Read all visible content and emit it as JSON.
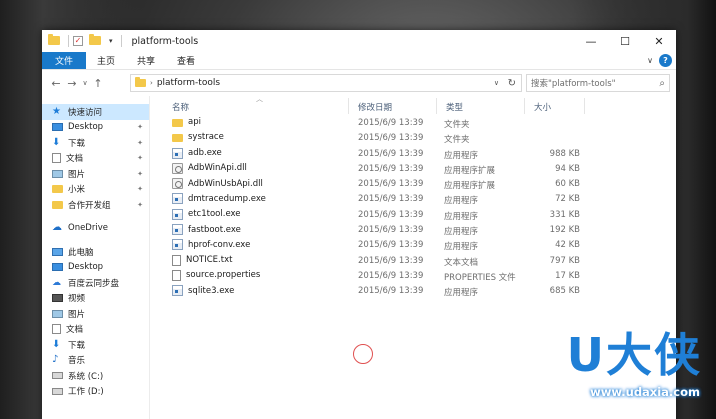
{
  "window": {
    "title": "platform-tools",
    "controls": {
      "minimize": "—",
      "maximize": "☐",
      "close": "✕"
    }
  },
  "ribbon": {
    "tabs": [
      "文件",
      "主页",
      "共享",
      "查看"
    ],
    "help": "?"
  },
  "nav": {
    "path": "platform-tools",
    "search_placeholder": "搜索\"platform-tools\""
  },
  "sidebar": {
    "items": [
      {
        "label": "快速访问",
        "icon": "star-icon",
        "selected": true,
        "pinned": false
      },
      {
        "label": "Desktop",
        "icon": "desktop-icon",
        "pinned": true
      },
      {
        "label": "下载",
        "icon": "download-icon",
        "pinned": true
      },
      {
        "label": "文档",
        "icon": "document-icon",
        "pinned": true
      },
      {
        "label": "图片",
        "icon": "picture-icon",
        "pinned": true
      },
      {
        "label": "小米",
        "icon": "folder-icon",
        "pinned": true
      },
      {
        "label": "合作开发组",
        "icon": "folder-icon",
        "pinned": true
      },
      {
        "label": "OneDrive",
        "icon": "cloud-icon",
        "pinned": false
      },
      {
        "label": "此电脑",
        "icon": "computer-icon",
        "pinned": false
      },
      {
        "label": "Desktop",
        "icon": "desktop-icon",
        "pinned": false
      },
      {
        "label": "百度云同步盘",
        "icon": "baidu-icon",
        "pinned": false
      },
      {
        "label": "视频",
        "icon": "video-icon",
        "pinned": false
      },
      {
        "label": "图片",
        "icon": "picture-icon",
        "pinned": false
      },
      {
        "label": "文档",
        "icon": "document-icon",
        "pinned": false
      },
      {
        "label": "下载",
        "icon": "download-icon",
        "pinned": false
      },
      {
        "label": "音乐",
        "icon": "music-icon",
        "pinned": false
      },
      {
        "label": "系统 (C:)",
        "icon": "drive-icon",
        "pinned": false
      },
      {
        "label": "工作 (D:)",
        "icon": "drive-icon",
        "pinned": false
      }
    ]
  },
  "columns": {
    "name": "名称",
    "date": "修改日期",
    "type": "类型",
    "size": "大小"
  },
  "files": [
    {
      "name": "api",
      "date": "2015/6/9 13:39",
      "type": "文件夹",
      "size": "",
      "kind": "folder"
    },
    {
      "name": "systrace",
      "date": "2015/6/9 13:39",
      "type": "文件夹",
      "size": "",
      "kind": "folder"
    },
    {
      "name": "adb.exe",
      "date": "2015/6/9 13:39",
      "type": "应用程序",
      "size": "988 KB",
      "kind": "exe"
    },
    {
      "name": "AdbWinApi.dll",
      "date": "2015/6/9 13:39",
      "type": "应用程序扩展",
      "size": "94 KB",
      "kind": "dll"
    },
    {
      "name": "AdbWinUsbApi.dll",
      "date": "2015/6/9 13:39",
      "type": "应用程序扩展",
      "size": "60 KB",
      "kind": "dll"
    },
    {
      "name": "dmtracedump.exe",
      "date": "2015/6/9 13:39",
      "type": "应用程序",
      "size": "72 KB",
      "kind": "exe"
    },
    {
      "name": "etc1tool.exe",
      "date": "2015/6/9 13:39",
      "type": "应用程序",
      "size": "331 KB",
      "kind": "exe"
    },
    {
      "name": "fastboot.exe",
      "date": "2015/6/9 13:39",
      "type": "应用程序",
      "size": "192 KB",
      "kind": "exe"
    },
    {
      "name": "hprof-conv.exe",
      "date": "2015/6/9 13:39",
      "type": "应用程序",
      "size": "42 KB",
      "kind": "exe"
    },
    {
      "name": "NOTICE.txt",
      "date": "2015/6/9 13:39",
      "type": "文本文档",
      "size": "797 KB",
      "kind": "txt"
    },
    {
      "name": "source.properties",
      "date": "2015/6/9 13:39",
      "type": "PROPERTIES 文件",
      "size": "17 KB",
      "kind": "txt"
    },
    {
      "name": "sqlite3.exe",
      "date": "2015/6/9 13:39",
      "type": "应用程序",
      "size": "685 KB",
      "kind": "exe"
    }
  ],
  "watermark": {
    "logo": "U大侠",
    "url": "www.udaxia.com"
  },
  "colors": {
    "accent": "#1979ca",
    "selected": "#cce8ff",
    "folder": "#f3c84a",
    "watermark": "#1f7fd6"
  }
}
